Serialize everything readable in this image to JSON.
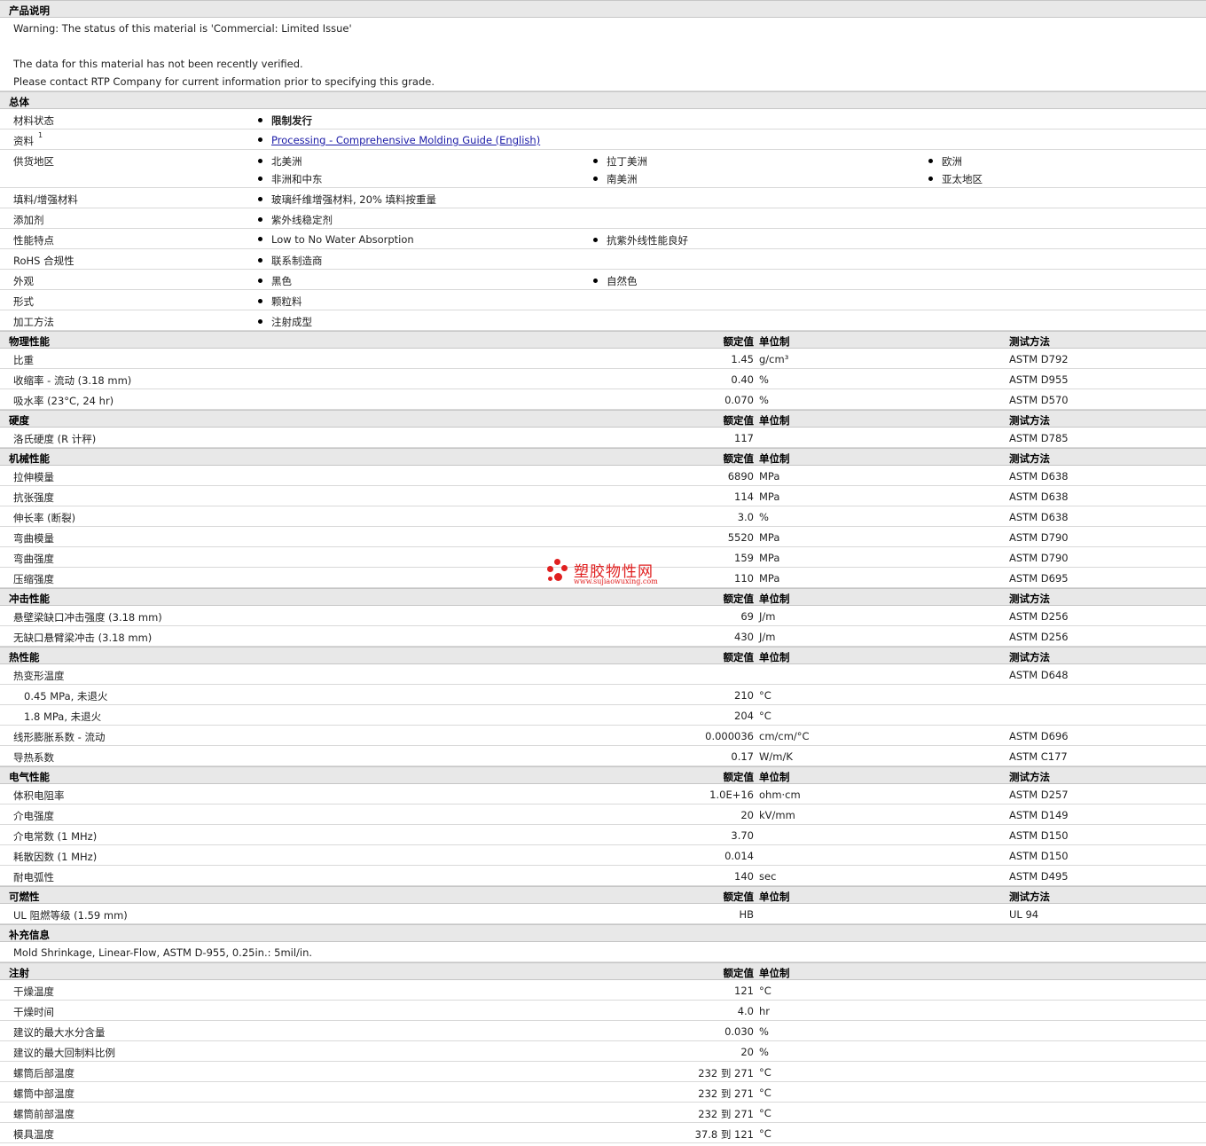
{
  "description": {
    "title": "产品说明",
    "lines": [
      "Warning: The status of this material is 'Commercial: Limited Issue'",
      "",
      "The data for this material has not been recently verified.",
      "Please contact RTP Company for current information prior to specifying this grade."
    ]
  },
  "general": {
    "title": "总体",
    "rows": [
      {
        "label": "材料状态",
        "items": [
          "限制发行"
        ],
        "style": "strong"
      },
      {
        "label": "资料",
        "sup": "1",
        "items": [
          "Processing - Comprehensive Molding Guide (English)"
        ],
        "style": "link"
      },
      {
        "label": "供货地区",
        "items": [
          "北美洲",
          "拉丁美洲",
          "欧洲",
          "非洲和中东",
          "南美洲",
          "亚太地区"
        ]
      },
      {
        "label": "填料/增强材料",
        "items": [
          "玻璃纤维增强材料, 20% 填料按重量"
        ]
      },
      {
        "label": "添加剂",
        "items": [
          "紫外线稳定剂"
        ]
      },
      {
        "label": "性能特点",
        "items": [
          "Low to No Water Absorption",
          "抗紫外线性能良好"
        ]
      },
      {
        "label": "RoHS 合规性",
        "items": [
          "联系制造商"
        ]
      },
      {
        "label": "外观",
        "items": [
          "黑色",
          "自然色"
        ]
      },
      {
        "label": "形式",
        "items": [
          "颗粒料"
        ]
      },
      {
        "label": "加工方法",
        "items": [
          "注射成型"
        ]
      }
    ]
  },
  "columns": {
    "value": "额定值",
    "unit": "单位制",
    "method": "测试方法"
  },
  "sections": [
    {
      "title": "物理性能",
      "has_method": true,
      "rows": [
        {
          "label": "比重",
          "value": "1.45",
          "unit": "g/cm³",
          "method": "ASTM D792"
        },
        {
          "label": "收缩率  - 流动 (3.18 mm)",
          "value": "0.40",
          "unit": "%",
          "method": "ASTM D955"
        },
        {
          "label": "吸水率 (23°C, 24 hr)",
          "value": "0.070",
          "unit": "%",
          "method": "ASTM D570"
        }
      ]
    },
    {
      "title": "硬度",
      "has_method": true,
      "rows": [
        {
          "label": "洛氏硬度 (R 计秤)",
          "value": "117",
          "unit": "",
          "method": "ASTM D785"
        }
      ]
    },
    {
      "title": "机械性能",
      "has_method": true,
      "rows": [
        {
          "label": "拉伸模量",
          "value": "6890",
          "unit": "MPa",
          "method": "ASTM D638"
        },
        {
          "label": "抗张强度",
          "value": "114",
          "unit": "MPa",
          "method": "ASTM D638"
        },
        {
          "label": "伸长率 (断裂)",
          "value": "3.0",
          "unit": "%",
          "method": "ASTM D638"
        },
        {
          "label": "弯曲模量",
          "value": "5520",
          "unit": "MPa",
          "method": "ASTM D790"
        },
        {
          "label": "弯曲强度",
          "value": "159",
          "unit": "MPa",
          "method": "ASTM D790"
        },
        {
          "label": "压缩强度",
          "value": "110",
          "unit": "MPa",
          "method": "ASTM D695"
        }
      ]
    },
    {
      "title": "冲击性能",
      "has_method": true,
      "rows": [
        {
          "label": "悬壁梁缺口冲击强度 (3.18 mm)",
          "value": "69",
          "unit": "J/m",
          "method": "ASTM D256"
        },
        {
          "label": "无缺口悬臂梁冲击 (3.18 mm)",
          "value": "430",
          "unit": "J/m",
          "method": "ASTM D256"
        }
      ]
    },
    {
      "title": "热性能",
      "has_method": true,
      "rows": [
        {
          "label": "热变形温度",
          "value": "",
          "unit": "",
          "method": "ASTM D648"
        },
        {
          "label": "0.45 MPa, 未退火",
          "indent": true,
          "value": "210",
          "unit": "°C",
          "method": ""
        },
        {
          "label": "1.8 MPa, 未退火",
          "indent": true,
          "value": "204",
          "unit": "°C",
          "method": ""
        },
        {
          "label": "线形膨胀系数  - 流动",
          "value": "0.000036",
          "unit": "cm/cm/°C",
          "method": "ASTM D696"
        },
        {
          "label": "导热系数",
          "value": "0.17",
          "unit": "W/m/K",
          "method": "ASTM C177"
        }
      ]
    },
    {
      "title": "电气性能",
      "has_method": true,
      "rows": [
        {
          "label": "体积电阻率",
          "value": "1.0E+16",
          "unit": "ohm·cm",
          "method": "ASTM D257"
        },
        {
          "label": "介电强度",
          "value": "20",
          "unit": "kV/mm",
          "method": "ASTM D149"
        },
        {
          "label": "介电常数 (1 MHz)",
          "value": "3.70",
          "unit": "",
          "method": "ASTM D150"
        },
        {
          "label": "耗散因数 (1 MHz)",
          "value": "0.014",
          "unit": "",
          "method": "ASTM D150"
        },
        {
          "label": "耐电弧性",
          "value": "140",
          "unit": "sec",
          "method": "ASTM D495"
        }
      ]
    },
    {
      "title": "可燃性",
      "has_method": true,
      "rows": [
        {
          "label": "UL 阻燃等级 (1.59 mm)",
          "value": "HB",
          "unit": "",
          "method": "UL 94"
        }
      ]
    }
  ],
  "supplementary": {
    "title": "补充信息",
    "text": "Mold Shrinkage, Linear-Flow, ASTM D-955, 0.25in.: 5mil/in."
  },
  "injection": {
    "title": "注射",
    "rows": [
      {
        "label": "干燥温度",
        "value": "121",
        "unit": "°C"
      },
      {
        "label": "干燥时间",
        "value": "4.0",
        "unit": "hr"
      },
      {
        "label": "建议的最大水分含量",
        "value": "0.030",
        "unit": "%"
      },
      {
        "label": "建议的最大回制料比例",
        "value": "20",
        "unit": "%"
      },
      {
        "label": "螺筒后部温度",
        "value": "232 到  271",
        "unit": "°C"
      },
      {
        "label": "螺筒中部温度",
        "value": "232 到  271",
        "unit": "°C"
      },
      {
        "label": "螺筒前部温度",
        "value": "232 到  271",
        "unit": "°C"
      },
      {
        "label": "模具温度",
        "value": "37.8 到  121",
        "unit": "°C"
      }
    ]
  },
  "watermark": {
    "name": "塑胶物性网",
    "url": "www.sujiaowuxing.com",
    "color": "#e02020"
  },
  "colors": {
    "header_bg": "#e8e8e8",
    "link": "#1a1aa6"
  }
}
